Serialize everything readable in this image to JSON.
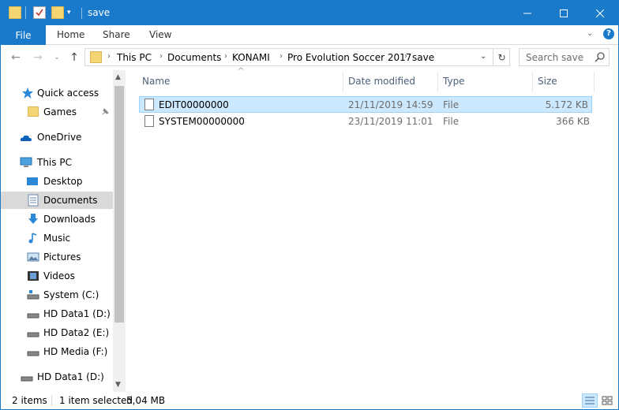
{
  "window": {
    "title": "save"
  },
  "ribbon": {
    "file": "File",
    "tabs": [
      "Home",
      "Share",
      "View"
    ]
  },
  "address": {
    "crumbs": [
      "This PC",
      "Documents",
      "KONAMI",
      "Pro Evolution Soccer 2017",
      "save"
    ]
  },
  "search": {
    "placeholder": "Search save"
  },
  "sidebar": {
    "items": [
      {
        "label": "Quick access",
        "icon": "star-icon"
      },
      {
        "label": "Games",
        "icon": "folder-icon"
      },
      {
        "label": "OneDrive",
        "icon": "cloud-icon"
      },
      {
        "label": "This PC",
        "icon": "computer-icon"
      },
      {
        "label": "Desktop",
        "icon": "desktop-icon"
      },
      {
        "label": "Documents",
        "icon": "documents-icon"
      },
      {
        "label": "Downloads",
        "icon": "download-icon"
      },
      {
        "label": "Music",
        "icon": "music-icon"
      },
      {
        "label": "Pictures",
        "icon": "pictures-icon"
      },
      {
        "label": "Videos",
        "icon": "videos-icon"
      },
      {
        "label": "System (C:)",
        "icon": "system-drive-icon"
      },
      {
        "label": "HD Data1 (D:)",
        "icon": "drive-icon"
      },
      {
        "label": "HD Data2 (E:)",
        "icon": "drive-icon"
      },
      {
        "label": "HD Media (F:)",
        "icon": "drive-icon"
      },
      {
        "label": "HD Data1 (D:)",
        "icon": "drive-icon"
      }
    ],
    "selected": "Documents"
  },
  "columns": {
    "name": "Name",
    "date": "Date modified",
    "type": "Type",
    "size": "Size"
  },
  "files": [
    {
      "name": "EDIT00000000",
      "date": "21/11/2019 14:59",
      "type": "File",
      "size": "5.172 KB",
      "selected": true
    },
    {
      "name": "SYSTEM00000000",
      "date": "23/11/2019 11:01",
      "type": "File",
      "size": "366 KB",
      "selected": false
    }
  ],
  "status": {
    "count": "2 items",
    "selection": "1 item selected",
    "selection_size": "5,04 MB"
  },
  "colors": {
    "accent": "#1979ca",
    "selected_row": "#cce8ff",
    "selected_border": "#99d1ff"
  }
}
